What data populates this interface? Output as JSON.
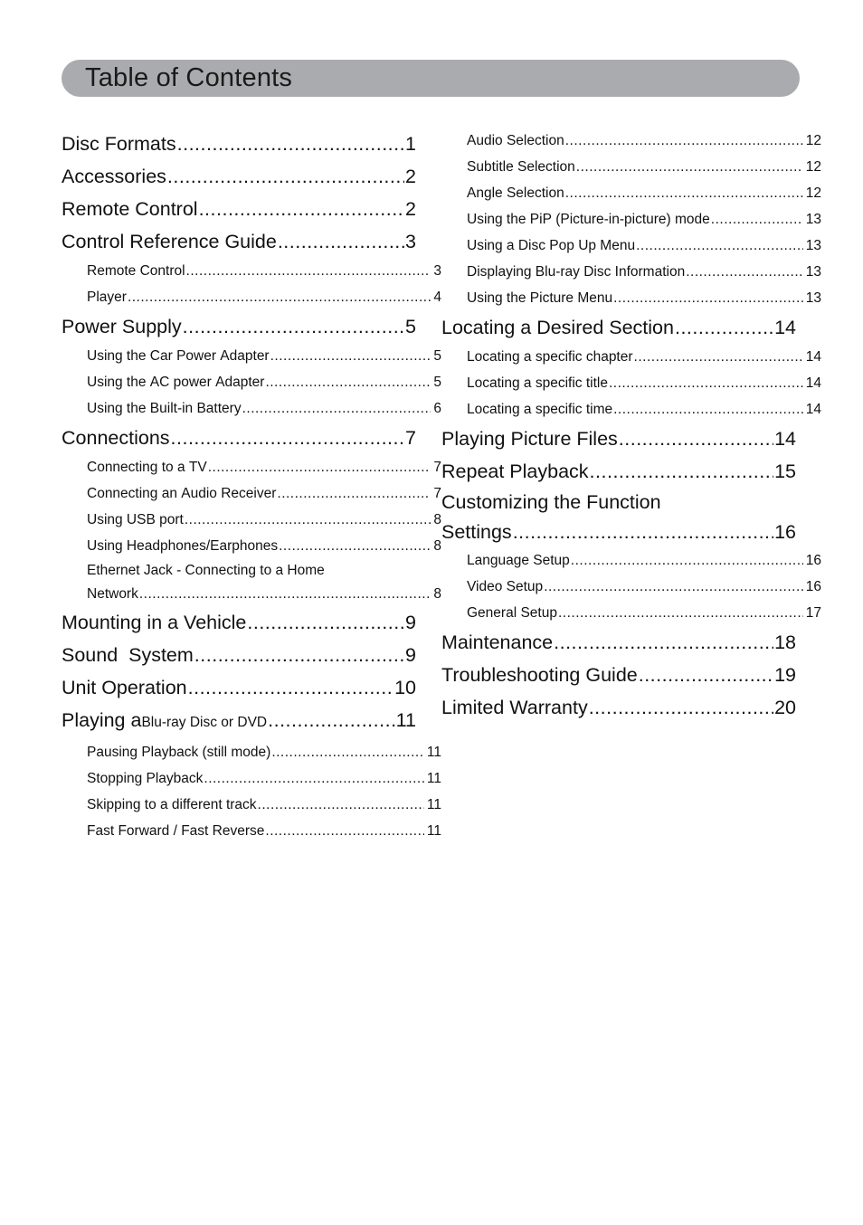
{
  "header": {
    "title": "Table of Contents",
    "background_color": "#a9abae"
  },
  "columns": {
    "left": [
      {
        "level": 1,
        "label": "Disc Formats",
        "page": "1"
      },
      {
        "level": 1,
        "label": "Accessories",
        "page": "2"
      },
      {
        "level": 1,
        "label": "Remote Control",
        "page": "2"
      },
      {
        "level": 1,
        "label": "Control Reference Guide",
        "page": "3"
      },
      {
        "level": 2,
        "label": "Remote Control",
        "page": "3"
      },
      {
        "level": 2,
        "label": "Player",
        "page": "4"
      },
      {
        "level": 1,
        "label": "Power Supply",
        "page": "5"
      },
      {
        "level": 2,
        "label": "Using the Car Power Adapter",
        "page": "5"
      },
      {
        "level": 2,
        "label": "Using the AC power Adapter",
        "page": "5"
      },
      {
        "level": 2,
        "label": "Using the Built-in Battery",
        "page": "6"
      },
      {
        "level": 1,
        "label": "Connections",
        "page": "7"
      },
      {
        "level": 2,
        "label": "Connecting to a TV",
        "page": "7"
      },
      {
        "level": 2,
        "label": "Connecting an Audio Receiver",
        "page": "7"
      },
      {
        "level": 2,
        "label": "Using USB port",
        "page": "8"
      },
      {
        "level": 2,
        "label": "Using Headphones/Earphones",
        "page": "8"
      },
      {
        "level": 2,
        "label": "Ethernet Jack - Connecting to a Home",
        "label_line2": "Network",
        "page": "8",
        "wrapped": true
      },
      {
        "level": 1,
        "label": "Mounting in a Vehicle",
        "page": "9"
      },
      {
        "level": 1,
        "label": "Sound  System",
        "page": "9"
      },
      {
        "level": 1,
        "label": "Unit Operation",
        "page": "10"
      },
      {
        "level": 1,
        "label": "Playing a ",
        "label_small": "Blu-ray Disc or DVD",
        "page": "11",
        "mixed": true
      },
      {
        "level": 2,
        "label": "Pausing Playback (still mode)",
        "page": "11"
      },
      {
        "level": 2,
        "label": "Stopping Playback",
        "page": "11"
      },
      {
        "level": 2,
        "label": "Skipping to a different track",
        "page": "11"
      },
      {
        "level": 2,
        "label": "Fast Forward / Fast Reverse",
        "page": "11"
      }
    ],
    "right": [
      {
        "level": 2,
        "label": "Audio Selection",
        "page": "12"
      },
      {
        "level": 2,
        "label": "Subtitle Selection",
        "page": "12"
      },
      {
        "level": 2,
        "label": "Angle Selection",
        "page": "12"
      },
      {
        "level": 2,
        "label": "Using the PiP (Picture-in-picture) mode",
        "page": "13"
      },
      {
        "level": 2,
        "label": "Using a Disc Pop Up Menu",
        "page": "13"
      },
      {
        "level": 2,
        "label": "Displaying Blu-ray Disc Information",
        "page": "13"
      },
      {
        "level": 2,
        "label": "Using the Picture Menu",
        "page": "13"
      },
      {
        "level": 1,
        "label": "Locating a Desired Section",
        "page": "14"
      },
      {
        "level": 2,
        "label": "Locating a specific chapter",
        "page": "14"
      },
      {
        "level": 2,
        "label": "Locating a specific title",
        "page": "14"
      },
      {
        "level": 2,
        "label": "Locating a specific time",
        "page": "14"
      },
      {
        "level": 1,
        "label": "Playing Picture Files",
        "page": "14"
      },
      {
        "level": 1,
        "label": "Repeat Playback",
        "page": "15"
      },
      {
        "level": 1,
        "label": "Customizing the Function",
        "label_line2": "Settings",
        "page": "16",
        "wrapped": true
      },
      {
        "level": 2,
        "label": "Language Setup",
        "page": "16"
      },
      {
        "level": 2,
        "label": "Video Setup",
        "page": "16"
      },
      {
        "level": 2,
        "label": "General Setup",
        "page": "17"
      },
      {
        "level": 1,
        "label": "Maintenance",
        "page": "18"
      },
      {
        "level": 1,
        "label": "Troubleshooting Guide",
        "page": "19"
      },
      {
        "level": 1,
        "label": "Limited Warranty",
        "page": "20"
      }
    ]
  }
}
